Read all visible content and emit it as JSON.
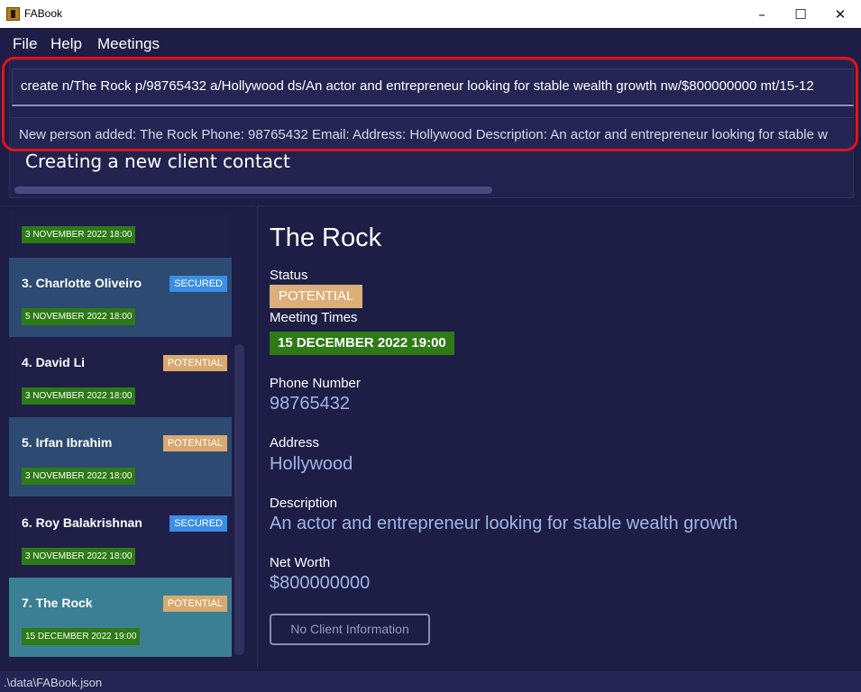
{
  "window": {
    "title": "FABook",
    "min": "–",
    "max": "☐",
    "close": "✕"
  },
  "menu": [
    "File",
    "Help",
    "Meetings"
  ],
  "command": {
    "value": "create n/The Rock p/98765432 a/Hollywood ds/An actor and entrepreneur looking for stable wealth growth nw/$800000000 mt/15-12"
  },
  "result": "New person added: The Rock Phone: 98765432 Email:  Address: Hollywood Description: An actor and entrepreneur looking for stable w",
  "annotation": "Creating a new client contact",
  "clients": [
    {
      "name": "",
      "status": "",
      "date": "3 NOVEMBER 2022 18:00"
    },
    {
      "name": "3.  Charlotte Oliveiro",
      "status": "SECURED",
      "date": "5 NOVEMBER 2022 18:00"
    },
    {
      "name": "4.  David Li",
      "status": "POTENTIAL",
      "date": "3 NOVEMBER 2022 18:00"
    },
    {
      "name": "5.  Irfan Ibrahim",
      "status": "POTENTIAL",
      "date": "3 NOVEMBER 2022 18:00"
    },
    {
      "name": "6.  Roy Balakrishnan",
      "status": "SECURED",
      "date": "3 NOVEMBER 2022 18:00"
    },
    {
      "name": "7.  The Rock",
      "status": "POTENTIAL",
      "date": "15 DECEMBER 2022 19:00"
    }
  ],
  "detail": {
    "name": "The Rock",
    "status_label": "Status",
    "status": "POTENTIAL",
    "meeting_label": "Meeting Times",
    "meeting": "15 DECEMBER 2022 19:00",
    "phone_label": "Phone Number",
    "phone": "98765432",
    "address_label": "Address",
    "address": "Hollywood",
    "description_label": "Description",
    "description": "An actor and entrepreneur looking for stable wealth growth",
    "networth_label": "Net Worth",
    "networth": "$800000000",
    "button": "No Client Information"
  },
  "statusbar": ".\\data\\FABook.json",
  "colors": {
    "card_dark": "#1f1f48",
    "card_mid": "#2c4a72",
    "card_selected": "#3a7f94",
    "potential": "#d9a96e",
    "secured": "#3a8ee6",
    "meeting": "#2d7a16"
  }
}
